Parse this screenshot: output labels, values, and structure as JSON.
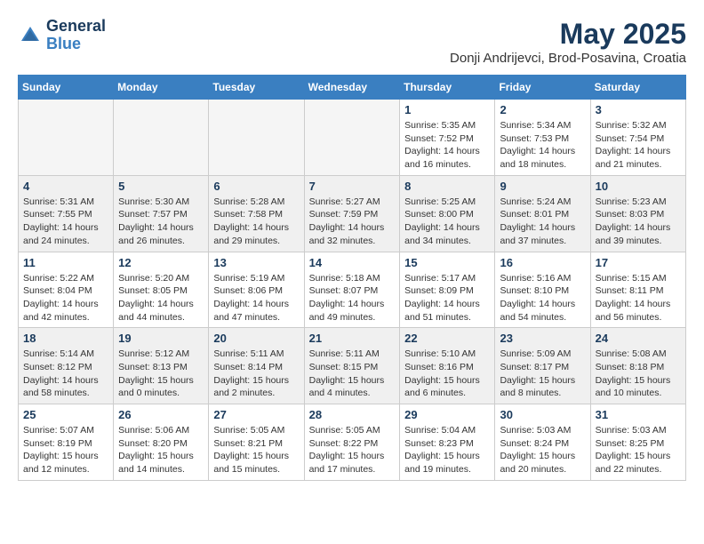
{
  "logo": {
    "line1": "General",
    "line2": "Blue"
  },
  "title": "May 2025",
  "location": "Donji Andrijevci, Brod-Posavina, Croatia",
  "headers": [
    "Sunday",
    "Monday",
    "Tuesday",
    "Wednesday",
    "Thursday",
    "Friday",
    "Saturday"
  ],
  "weeks": [
    [
      {
        "day": "",
        "info": ""
      },
      {
        "day": "",
        "info": ""
      },
      {
        "day": "",
        "info": ""
      },
      {
        "day": "",
        "info": ""
      },
      {
        "day": "1",
        "info": "Sunrise: 5:35 AM\nSunset: 7:52 PM\nDaylight: 14 hours\nand 16 minutes."
      },
      {
        "day": "2",
        "info": "Sunrise: 5:34 AM\nSunset: 7:53 PM\nDaylight: 14 hours\nand 18 minutes."
      },
      {
        "day": "3",
        "info": "Sunrise: 5:32 AM\nSunset: 7:54 PM\nDaylight: 14 hours\nand 21 minutes."
      }
    ],
    [
      {
        "day": "4",
        "info": "Sunrise: 5:31 AM\nSunset: 7:55 PM\nDaylight: 14 hours\nand 24 minutes."
      },
      {
        "day": "5",
        "info": "Sunrise: 5:30 AM\nSunset: 7:57 PM\nDaylight: 14 hours\nand 26 minutes."
      },
      {
        "day": "6",
        "info": "Sunrise: 5:28 AM\nSunset: 7:58 PM\nDaylight: 14 hours\nand 29 minutes."
      },
      {
        "day": "7",
        "info": "Sunrise: 5:27 AM\nSunset: 7:59 PM\nDaylight: 14 hours\nand 32 minutes."
      },
      {
        "day": "8",
        "info": "Sunrise: 5:25 AM\nSunset: 8:00 PM\nDaylight: 14 hours\nand 34 minutes."
      },
      {
        "day": "9",
        "info": "Sunrise: 5:24 AM\nSunset: 8:01 PM\nDaylight: 14 hours\nand 37 minutes."
      },
      {
        "day": "10",
        "info": "Sunrise: 5:23 AM\nSunset: 8:03 PM\nDaylight: 14 hours\nand 39 minutes."
      }
    ],
    [
      {
        "day": "11",
        "info": "Sunrise: 5:22 AM\nSunset: 8:04 PM\nDaylight: 14 hours\nand 42 minutes."
      },
      {
        "day": "12",
        "info": "Sunrise: 5:20 AM\nSunset: 8:05 PM\nDaylight: 14 hours\nand 44 minutes."
      },
      {
        "day": "13",
        "info": "Sunrise: 5:19 AM\nSunset: 8:06 PM\nDaylight: 14 hours\nand 47 minutes."
      },
      {
        "day": "14",
        "info": "Sunrise: 5:18 AM\nSunset: 8:07 PM\nDaylight: 14 hours\nand 49 minutes."
      },
      {
        "day": "15",
        "info": "Sunrise: 5:17 AM\nSunset: 8:09 PM\nDaylight: 14 hours\nand 51 minutes."
      },
      {
        "day": "16",
        "info": "Sunrise: 5:16 AM\nSunset: 8:10 PM\nDaylight: 14 hours\nand 54 minutes."
      },
      {
        "day": "17",
        "info": "Sunrise: 5:15 AM\nSunset: 8:11 PM\nDaylight: 14 hours\nand 56 minutes."
      }
    ],
    [
      {
        "day": "18",
        "info": "Sunrise: 5:14 AM\nSunset: 8:12 PM\nDaylight: 14 hours\nand 58 minutes."
      },
      {
        "day": "19",
        "info": "Sunrise: 5:12 AM\nSunset: 8:13 PM\nDaylight: 15 hours\nand 0 minutes."
      },
      {
        "day": "20",
        "info": "Sunrise: 5:11 AM\nSunset: 8:14 PM\nDaylight: 15 hours\nand 2 minutes."
      },
      {
        "day": "21",
        "info": "Sunrise: 5:11 AM\nSunset: 8:15 PM\nDaylight: 15 hours\nand 4 minutes."
      },
      {
        "day": "22",
        "info": "Sunrise: 5:10 AM\nSunset: 8:16 PM\nDaylight: 15 hours\nand 6 minutes."
      },
      {
        "day": "23",
        "info": "Sunrise: 5:09 AM\nSunset: 8:17 PM\nDaylight: 15 hours\nand 8 minutes."
      },
      {
        "day": "24",
        "info": "Sunrise: 5:08 AM\nSunset: 8:18 PM\nDaylight: 15 hours\nand 10 minutes."
      }
    ],
    [
      {
        "day": "25",
        "info": "Sunrise: 5:07 AM\nSunset: 8:19 PM\nDaylight: 15 hours\nand 12 minutes."
      },
      {
        "day": "26",
        "info": "Sunrise: 5:06 AM\nSunset: 8:20 PM\nDaylight: 15 hours\nand 14 minutes."
      },
      {
        "day": "27",
        "info": "Sunrise: 5:05 AM\nSunset: 8:21 PM\nDaylight: 15 hours\nand 15 minutes."
      },
      {
        "day": "28",
        "info": "Sunrise: 5:05 AM\nSunset: 8:22 PM\nDaylight: 15 hours\nand 17 minutes."
      },
      {
        "day": "29",
        "info": "Sunrise: 5:04 AM\nSunset: 8:23 PM\nDaylight: 15 hours\nand 19 minutes."
      },
      {
        "day": "30",
        "info": "Sunrise: 5:03 AM\nSunset: 8:24 PM\nDaylight: 15 hours\nand 20 minutes."
      },
      {
        "day": "31",
        "info": "Sunrise: 5:03 AM\nSunset: 8:25 PM\nDaylight: 15 hours\nand 22 minutes."
      }
    ]
  ]
}
